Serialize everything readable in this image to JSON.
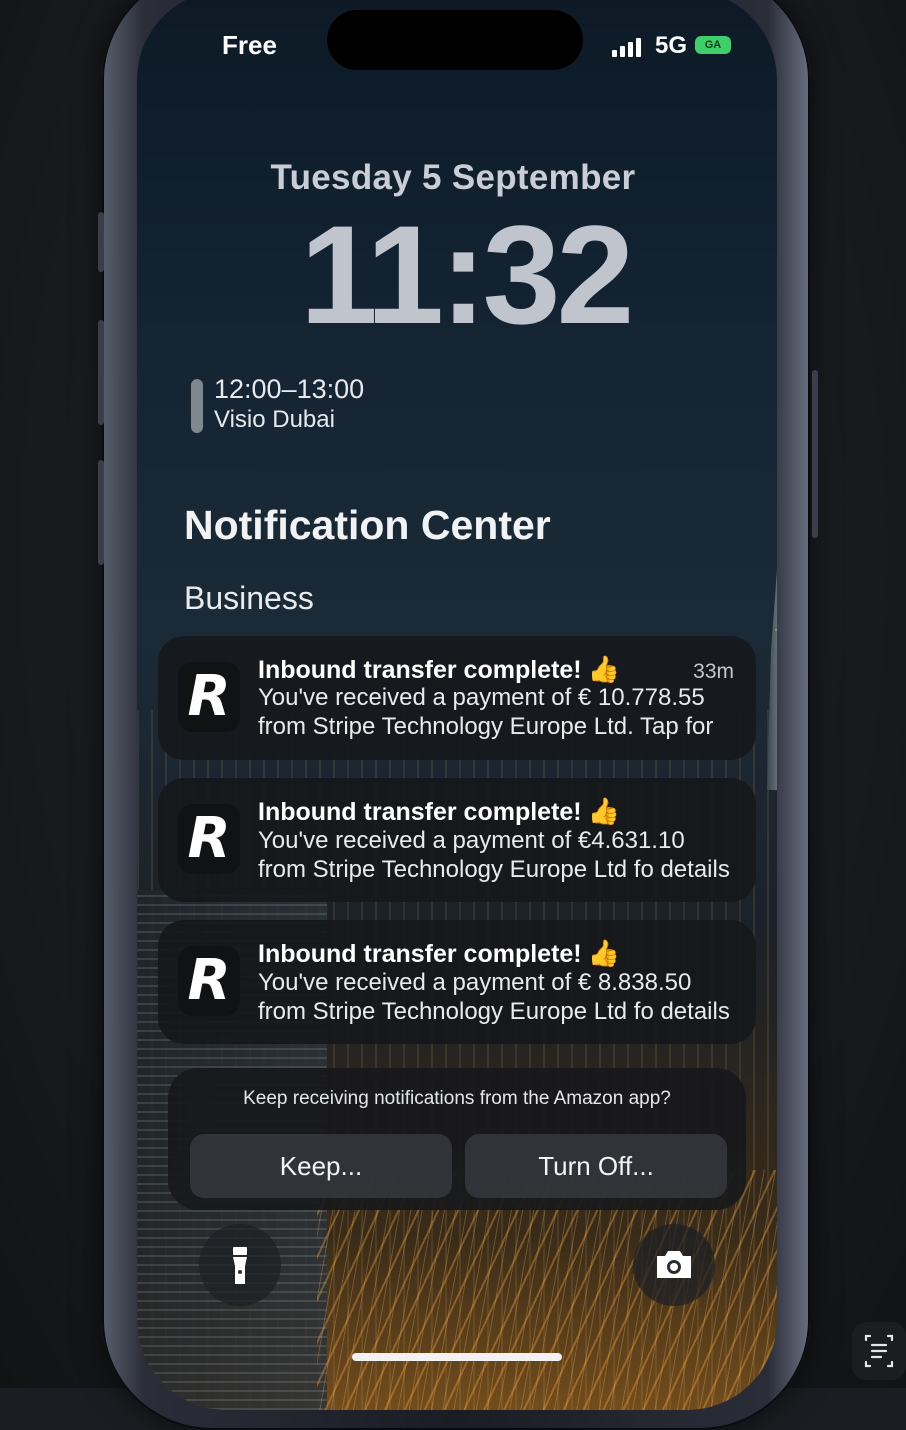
{
  "status_bar": {
    "carrier": "Free",
    "network": "5G",
    "battery_label": "GA"
  },
  "lock_screen": {
    "date": "Tuesday 5 September",
    "time": "11:32",
    "calendar_event": {
      "time_range": "12:00–13:00",
      "title": "Visio Dubai"
    }
  },
  "notification_center": {
    "title": "Notification Center",
    "section": "Business",
    "notifications": [
      {
        "app_icon": "R",
        "title": "Inbound transfer complete!",
        "emoji": "👍",
        "age": "33m",
        "line1": "You've received a payment of € 10.778.55",
        "line2": "from Stripe Technology Europe Ltd. Tap for"
      },
      {
        "app_icon": "R",
        "title": "Inbound transfer complete!",
        "emoji": "👍",
        "age": "",
        "line1": "You've received a payment of €4.631.10",
        "line2": "from Stripe Technology Europe Ltd fo details"
      },
      {
        "app_icon": "R",
        "title": "Inbound transfer complete!",
        "emoji": "👍",
        "age": "",
        "line1": "You've received a payment of € 8.838.50",
        "line2": "from Stripe Technology Europe Ltd fo details"
      }
    ]
  },
  "notification_prompt": {
    "text": "Keep receiving notifications from the Amazon app?",
    "keep_label": "Keep...",
    "turn_off_label": "Turn Off..."
  },
  "quick_actions": {
    "left_icon": "flashlight-icon",
    "right_icon": "camera-icon"
  },
  "colors": {
    "battery": "#3fcf6a",
    "notification_bg": "#16181b",
    "emoji": "#e6b23a"
  }
}
